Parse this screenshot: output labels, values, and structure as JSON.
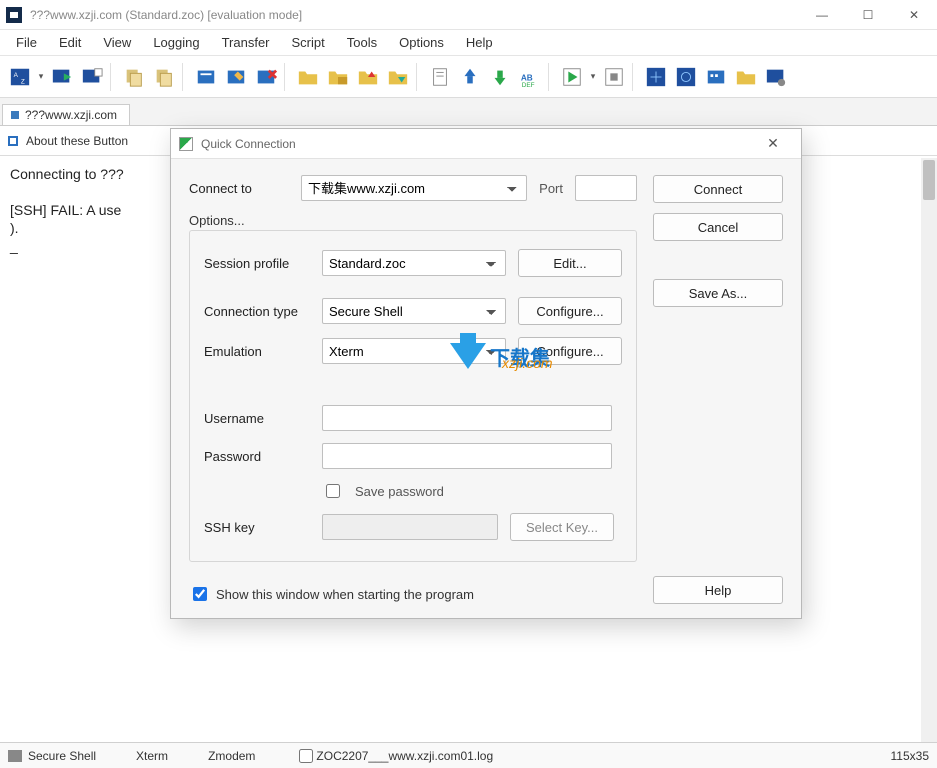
{
  "window": {
    "title": "???www.xzji.com (Standard.zoc) [evaluation mode]"
  },
  "menu": [
    "File",
    "Edit",
    "View",
    "Logging",
    "Transfer",
    "Script",
    "Tools",
    "Options",
    "Help"
  ],
  "tabs": [
    {
      "label": "???www.xzji.com",
      "active": true
    }
  ],
  "button_row": {
    "label": "About these Button"
  },
  "terminal_lines": [
    "Connecting to ???",
    "",
    "[SSH] FAIL: A use                                                                                  enter the name",
    ").",
    "_"
  ],
  "dialog": {
    "title": "Quick Connection",
    "connect_to_label": "Connect to",
    "connect_to_value": "下载集www.xzji.com",
    "port_label": "Port",
    "port_value": "",
    "options_label": "Options...",
    "session_profile_label": "Session profile",
    "session_profile_value": "Standard.zoc",
    "edit_label": "Edit...",
    "connection_type_label": "Connection type",
    "connection_type_value": "Secure Shell",
    "configure1_label": "Configure...",
    "emulation_label": "Emulation",
    "emulation_value": "Xterm",
    "configure2_label": "Configure...",
    "username_label": "Username",
    "username_value": "",
    "password_label": "Password",
    "password_value": "",
    "save_password_label": "Save password",
    "save_password_checked": false,
    "sshkey_label": "SSH key",
    "sshkey_value": "",
    "select_key_label": "Select Key...",
    "show_startup_label": "Show this window when starting the program",
    "show_startup_checked": true,
    "buttons": {
      "connect": "Connect",
      "cancel": "Cancel",
      "save_as": "Save As...",
      "help": "Help"
    }
  },
  "statusbar": {
    "protocol": "Secure Shell",
    "emulation": "Xterm",
    "transfer": "Zmodem",
    "logfile": "ZOC2207___www.xzji.com01.log",
    "size": "115x35"
  },
  "watermark": {
    "brand": "下载集",
    "url": "xzji.com"
  },
  "toolbar_icons": [
    "host-directory-icon",
    "quick-connect-icon",
    "reconnect-icon",
    "copy-icon",
    "paste-icon",
    "profile-icon",
    "edit-profile-icon",
    "delete-profile-icon",
    "new-folder-icon",
    "open-folder-icon",
    "folder-up-icon",
    "folder-down-icon",
    "log-icon",
    "upload-icon",
    "download-icon",
    "spell-icon",
    "run-script-icon",
    "stop-script-icon",
    "find-icon",
    "crosshair-icon",
    "keymap-icon",
    "macro-folder-icon",
    "device-icon"
  ]
}
